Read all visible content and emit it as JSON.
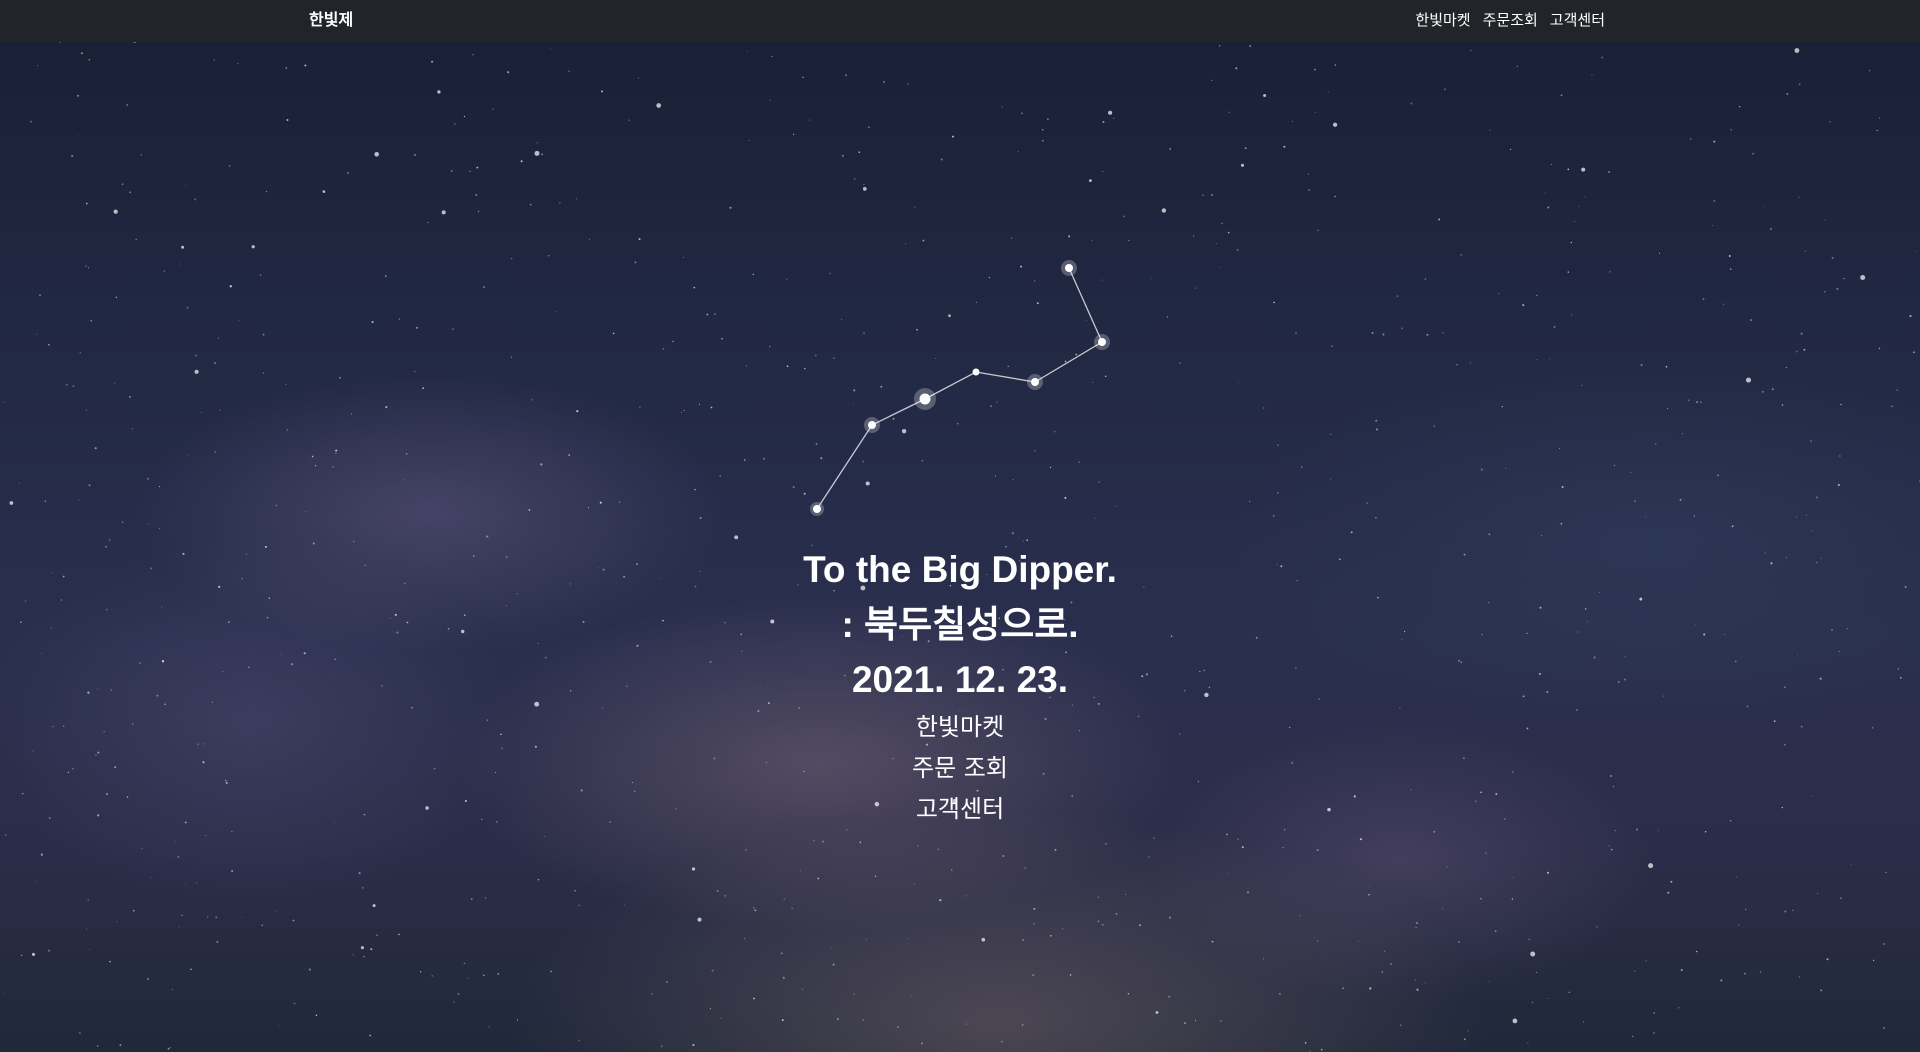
{
  "navbar": {
    "brand": "한빛제",
    "links": [
      {
        "label": "한빛마켓"
      },
      {
        "label": "주문조회"
      },
      {
        "label": "고객센터"
      }
    ]
  },
  "hero": {
    "line1": "To the Big Dipper.",
    "line2": ": 북두칠성으로.",
    "line3": "2021. 12. 23.",
    "links": [
      {
        "label": "한빛마켓"
      },
      {
        "label": "주문 조회"
      },
      {
        "label": "고객센터"
      }
    ]
  },
  "colors": {
    "navbar_bg": "#212529",
    "text": "#ffffff",
    "sky_dark": "#1a2036"
  }
}
